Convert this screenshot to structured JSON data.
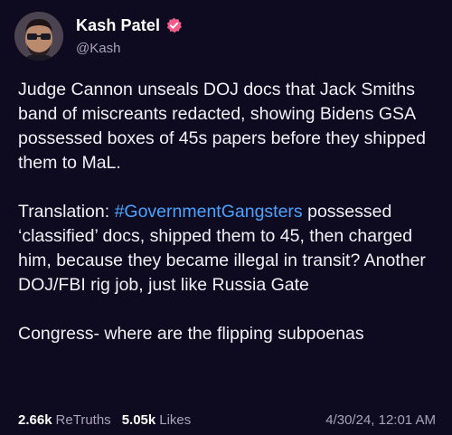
{
  "author": {
    "display_name": "Kash Patel",
    "handle": "@Kash",
    "verified_icon": "verified-badge-icon",
    "verified_color": "#f25c8b"
  },
  "post": {
    "paragraph1": "Judge Cannon unseals DOJ docs that Jack Smiths band of miscreants redacted, showing Bidens GSA possessed boxes of 45s papers before they shipped them to MaL.",
    "p2_prefix": "Translation: ",
    "p2_hashtag": "#GovernmentGangsters",
    "p2_suffix": " possessed ‘classified’ docs, shipped them to 45, then charged him, because they became illegal in transit? Another DOJ/FBI rig job, just like Russia Gate",
    "paragraph3": "Congress- where are the flipping subpoenas"
  },
  "stats": {
    "retruths_count": "2.66k",
    "retruths_label": "ReTruths",
    "likes_count": "5.05k",
    "likes_label": "Likes"
  },
  "timestamp": "4/30/24, 12:01 AM",
  "colors": {
    "background": "#0e0a1f",
    "hashtag": "#4aa3ff",
    "muted": "#a9a3b8"
  }
}
